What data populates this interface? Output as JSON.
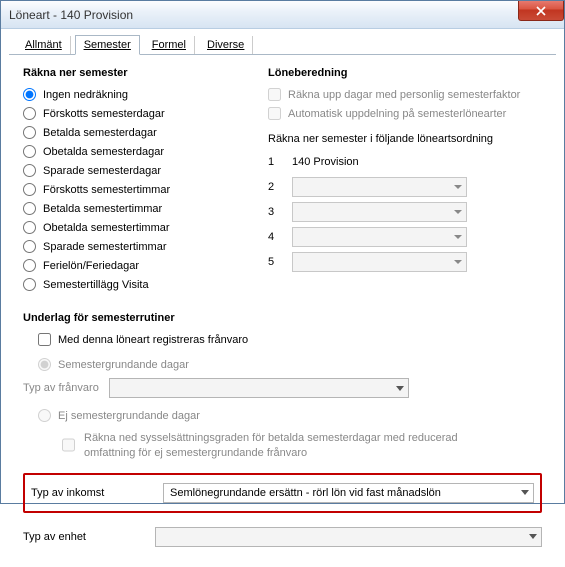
{
  "window": {
    "title": "Löneart - 140  Provision"
  },
  "tabs": {
    "t0": "Allmänt",
    "t1": "Semester",
    "t2": "Formel",
    "t3": "Diverse"
  },
  "rakna": {
    "title": "Räkna ner semester",
    "r0": "Ingen nedräkning",
    "r1": "Förskotts semesterdagar",
    "r2": "Betalda semesterdagar",
    "r3": "Obetalda semesterdagar",
    "r4": "Sparade semesterdagar",
    "r5": "Förskotts semestertimmar",
    "r6": "Betalda semestertimmar",
    "r7": "Obetalda semestertimmar",
    "r8": "Sparade semestertimmar",
    "r9": "Ferielön/Feriedagar",
    "r10": "Semestertillägg Visita"
  },
  "lone": {
    "title": "Löneberedning",
    "c0": "Räkna upp dagar med personlig semesterfaktor",
    "c1": "Automatisk uppdelning på semesterlönearter",
    "order_label": "Räkna ner semester i följande löneartsordning",
    "rows": {
      "n1": "1",
      "v1": "140 Provision",
      "n2": "2",
      "n3": "3",
      "n4": "4",
      "n5": "5"
    }
  },
  "underlag": {
    "title": "Underlag för semesterrutiner",
    "c0": "Med denna löneart registreras frånvaro",
    "r0": "Semestergrundande dagar",
    "fran_label": "Typ av frånvaro",
    "r1": "Ej semestergrundande dagar",
    "sub": "Räkna ned sysselsättningsgraden för betalda semesterdagar med reducerad omfattning för ej semestergrundande frånvaro"
  },
  "typ_inkomst": {
    "label": "Typ av inkomst",
    "value": "Semlönegrundande ersättn - rörl lön vid fast månadslön"
  },
  "typ_enhet": {
    "label": "Typ av enhet",
    "value": ""
  }
}
